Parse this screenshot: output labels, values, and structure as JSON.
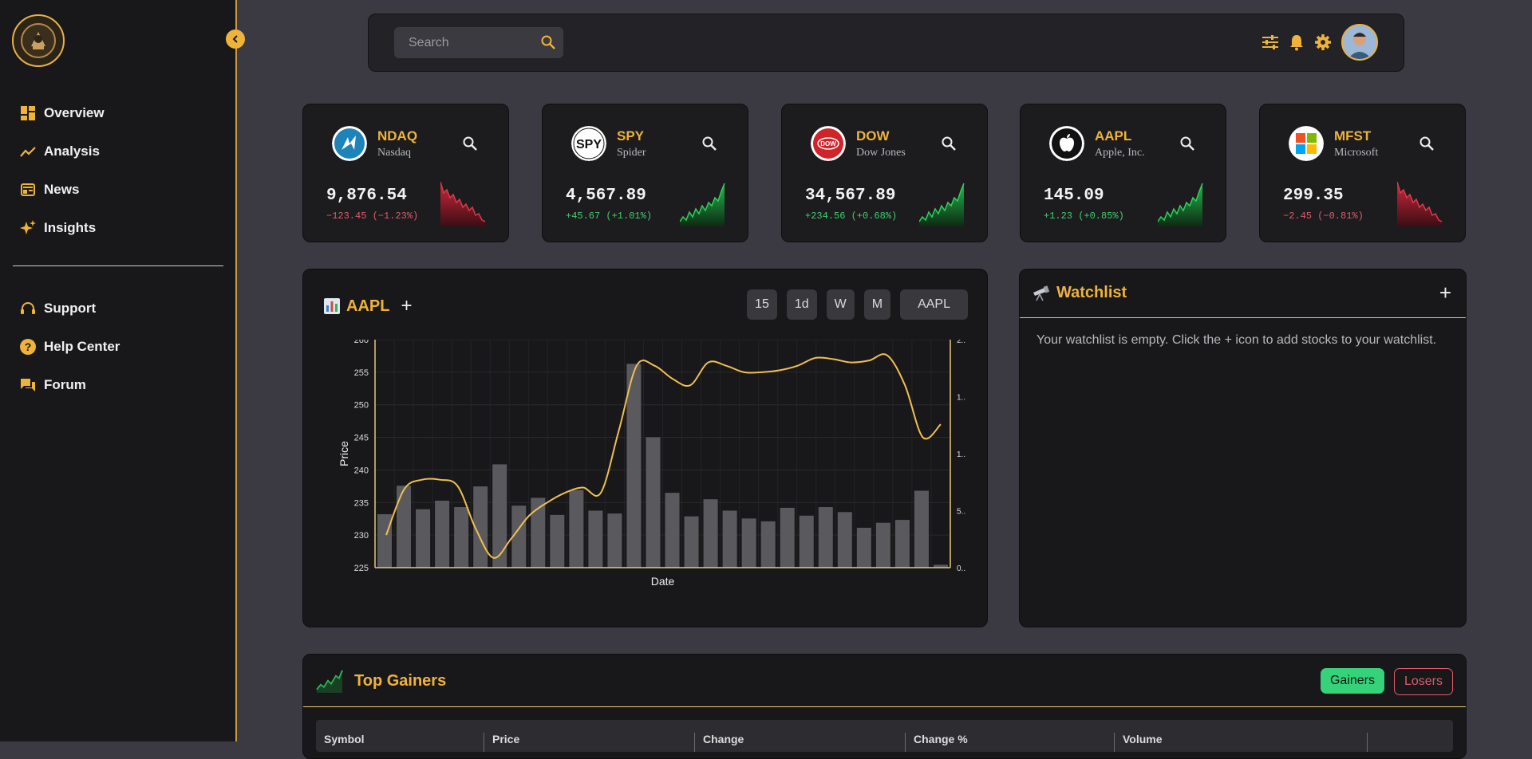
{
  "sidebar": {
    "nav": [
      {
        "label": "Overview",
        "icon": "dashboard-icon"
      },
      {
        "label": "Analysis",
        "icon": "trend-icon"
      },
      {
        "label": "News",
        "icon": "news-icon"
      },
      {
        "label": "Insights",
        "icon": "sparkle-icon"
      }
    ],
    "support": [
      {
        "label": "Support",
        "icon": "headset-icon"
      },
      {
        "label": "Help Center",
        "icon": "help-icon"
      },
      {
        "label": "Forum",
        "icon": "forum-icon"
      }
    ]
  },
  "topbar": {
    "search_placeholder": "Search"
  },
  "tickers": [
    {
      "symbol": "NDAQ",
      "name": "Nasdaq",
      "price": "9,876.54",
      "change": "−123.45 (−1.23%)",
      "trend": "down"
    },
    {
      "symbol": "SPY",
      "name": "Spider",
      "price": "4,567.89",
      "change": "+45.67 (+1.01%)",
      "trend": "up"
    },
    {
      "symbol": "DOW",
      "name": "Dow Jones",
      "price": "34,567.89",
      "change": "+234.56 (+0.68%)",
      "trend": "up"
    },
    {
      "symbol": "AAPL",
      "name": "Apple, Inc.",
      "price": "145.09",
      "change": "+1.23 (+0.85%)",
      "trend": "up"
    },
    {
      "symbol": "MFST",
      "name": "Microsoft",
      "price": "299.35",
      "change": "−2.45 (−0.81%)",
      "trend": "down"
    }
  ],
  "chart_panel": {
    "symbol": "AAPL",
    "ranges": [
      "15",
      "1d",
      "W",
      "M"
    ],
    "symbol_button": "AAPL"
  },
  "chart_data": {
    "type": "line",
    "xlabel": "Date",
    "ylabel": "Price",
    "ylim": [
      225,
      260
    ],
    "yticks": [
      "260",
      "255",
      "250",
      "245",
      "240",
      "235",
      "230",
      "225"
    ],
    "y2ticks": [
      "2..",
      "1..",
      "1..",
      "5..",
      "0.."
    ],
    "series": [
      {
        "values": [
          230,
          237,
          238.5,
          238.5,
          237.5,
          231,
          226.5,
          229.5,
          233,
          235,
          236.5,
          237.3,
          236.5,
          246,
          256,
          256,
          254,
          253,
          256.5,
          256,
          255,
          255,
          255.3,
          256,
          257.2,
          257,
          256.5,
          256.8,
          257.6,
          253,
          245,
          247
        ],
        "color": "#f0c050"
      },
      {
        "values": [
          7.5,
          11.5,
          8.2,
          9.4,
          8.5,
          11.4,
          14.5,
          8.7,
          9.8,
          7.4,
          10.9,
          8.0,
          7.6,
          28.6,
          18.3,
          10.5,
          7.2,
          9.6,
          8.0,
          6.9,
          6.5,
          8.4,
          7.3,
          8.5,
          7.8,
          5.6,
          6.3,
          6.7,
          10.8,
          0.4
        ],
        "color": "#5a5a5e"
      }
    ]
  },
  "watchlist": {
    "title": "Watchlist",
    "empty_text": "Your watchlist is empty. Click the + icon to add stocks to your watchlist."
  },
  "gainers": {
    "title": "Top Gainers",
    "btn_gainers": "Gainers",
    "btn_losers": "Losers",
    "columns": [
      "Symbol",
      "Price",
      "Change",
      "Change %",
      "Volume"
    ]
  }
}
